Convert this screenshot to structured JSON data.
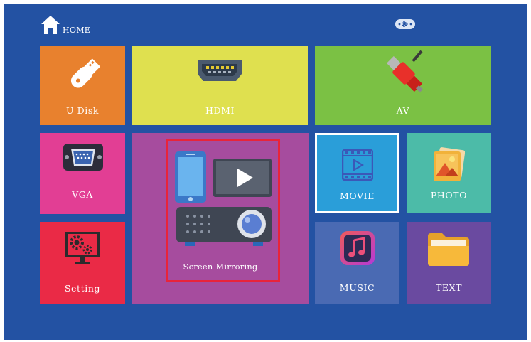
{
  "header": {
    "home_label": "HOME"
  },
  "tiles": {
    "udisk": {
      "label": "U Disk",
      "color": "#e8812e"
    },
    "hdmi": {
      "label": "HDMI",
      "color": "#dfe04f"
    },
    "av": {
      "label": "AV",
      "color": "#7bc144"
    },
    "vga": {
      "label": "VGA",
      "color": "#e23e94"
    },
    "screen_mirroring": {
      "label": "Screen Mirroring",
      "color": "#a64c9e"
    },
    "movie": {
      "label": "MOVIE",
      "color": "#2a9ed9"
    },
    "photo": {
      "label": "PHOTO",
      "color": "#4cbba8"
    },
    "setting": {
      "label": "Setting",
      "color": "#ea2a46"
    },
    "music": {
      "label": "MUSIC",
      "color": "#4a6ab3"
    },
    "text": {
      "label": "TEXT",
      "color": "#6a4aa0"
    }
  },
  "colors": {
    "background": "#2352a3",
    "selection_border": "#ffffff",
    "focus_frame": "#e8243a"
  },
  "icons": {
    "home": "home-icon",
    "bluetooth": "bluetooth-icon",
    "udisk": "usb-drive-icon",
    "hdmi": "hdmi-port-icon",
    "av": "rca-cable-icon",
    "vga": "vga-port-icon",
    "screen_mirroring": "screen-mirroring-icon",
    "movie": "film-play-icon",
    "photo": "photo-gallery-icon",
    "setting": "settings-gears-icon",
    "music": "music-note-icon",
    "text": "folder-icon"
  }
}
